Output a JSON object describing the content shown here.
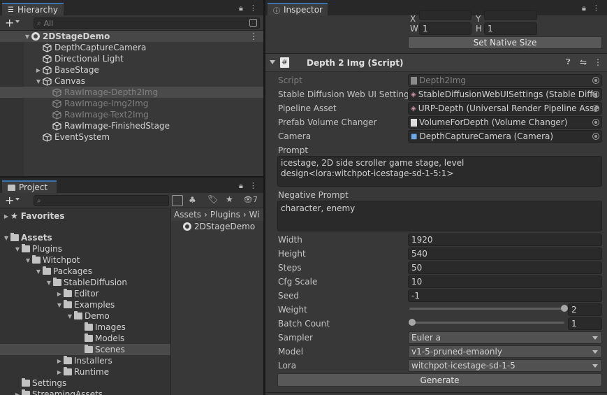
{
  "hierarchy": {
    "tab_label": "Hierarchy",
    "search_placeholder": "All",
    "lock_icon": "lock-icon",
    "menu_icon": "kebab-menu-icon",
    "scene": "2DStageDemo",
    "items": [
      {
        "label": "DepthCaptureCamera",
        "dimmed": false
      },
      {
        "label": "Directional Light",
        "dimmed": false
      },
      {
        "label": "BaseStage",
        "dimmed": false,
        "collapsed": true
      },
      {
        "label": "Canvas",
        "dimmed": false,
        "expanded": true
      },
      {
        "label": "RawImage-Depth2Img",
        "dimmed": true,
        "selected": true
      },
      {
        "label": "RawImage-Img2Img",
        "dimmed": true
      },
      {
        "label": "RawImage-Text2Img",
        "dimmed": true
      },
      {
        "label": "RawImage-FinishedStage",
        "dimmed": false
      },
      {
        "label": "EventSystem",
        "dimmed": false
      }
    ]
  },
  "project": {
    "tab_label": "Project",
    "hidden_count": "7",
    "favorites": "Favorites",
    "assets": "Assets",
    "tree": [
      "Plugins",
      "Witchpot",
      "Packages",
      "StableDiffusion",
      "Editor",
      "Examples",
      "Demo",
      "Images",
      "Models",
      "Scenes",
      "Installers",
      "Runtime",
      "Settings",
      "StreamingAssets"
    ],
    "breadcrumb": [
      "Assets",
      "Plugins",
      "Wi"
    ],
    "asset_item": "2DStageDemo"
  },
  "inspector": {
    "tab_label": "Inspector",
    "rect_labels": {
      "x": "X",
      "y": "Y",
      "w": "W",
      "h": "H"
    },
    "w_value": "1",
    "h_value": "1",
    "set_native_size": "Set Native Size",
    "component_title": "Depth 2 Img (Script)",
    "script_label": "Script",
    "script_value": "Depth2Img",
    "sd_label": "Stable Diffusion Web UI Settings",
    "sd_value": "StableDiffusionWebUISettings (Stable Diffu",
    "pipeline_label": "Pipeline Asset",
    "pipeline_value": "URP-Depth (Universal Render Pipeline Asse",
    "volume_label": "Prefab Volume Changer",
    "volume_value": "VolumeForDepth (Volume Changer)",
    "camera_label": "Camera",
    "camera_value": "DepthCaptureCamera (Camera)",
    "prompt_label": "Prompt",
    "prompt_line1": "icestage, 2D side scroller game stage, level",
    "prompt_line2": "design<lora:witchpot-icestage-sd-1-5:1>",
    "neg_label": "Negative Prompt",
    "neg_value": "character, enemy",
    "width_label": "Width",
    "width_value": "1920",
    "height_label": "Height",
    "height_value": "540",
    "steps_label": "Steps",
    "steps_value": "50",
    "cfg_label": "Cfg Scale",
    "cfg_value": "10",
    "seed_label": "Seed",
    "seed_value": "-1",
    "weight_label": "Weight",
    "weight_value": "2",
    "weight_fraction": 1.0,
    "batch_label": "Batch Count",
    "batch_value": "1",
    "batch_fraction": 0.0,
    "sampler_label": "Sampler",
    "sampler_value": "Euler a",
    "model_label": "Model",
    "model_value": "v1-5-pruned-emaonly",
    "lora_label": "Lora",
    "lora_value": "witchpot-icestage-sd-1-5",
    "generate": "Generate"
  }
}
